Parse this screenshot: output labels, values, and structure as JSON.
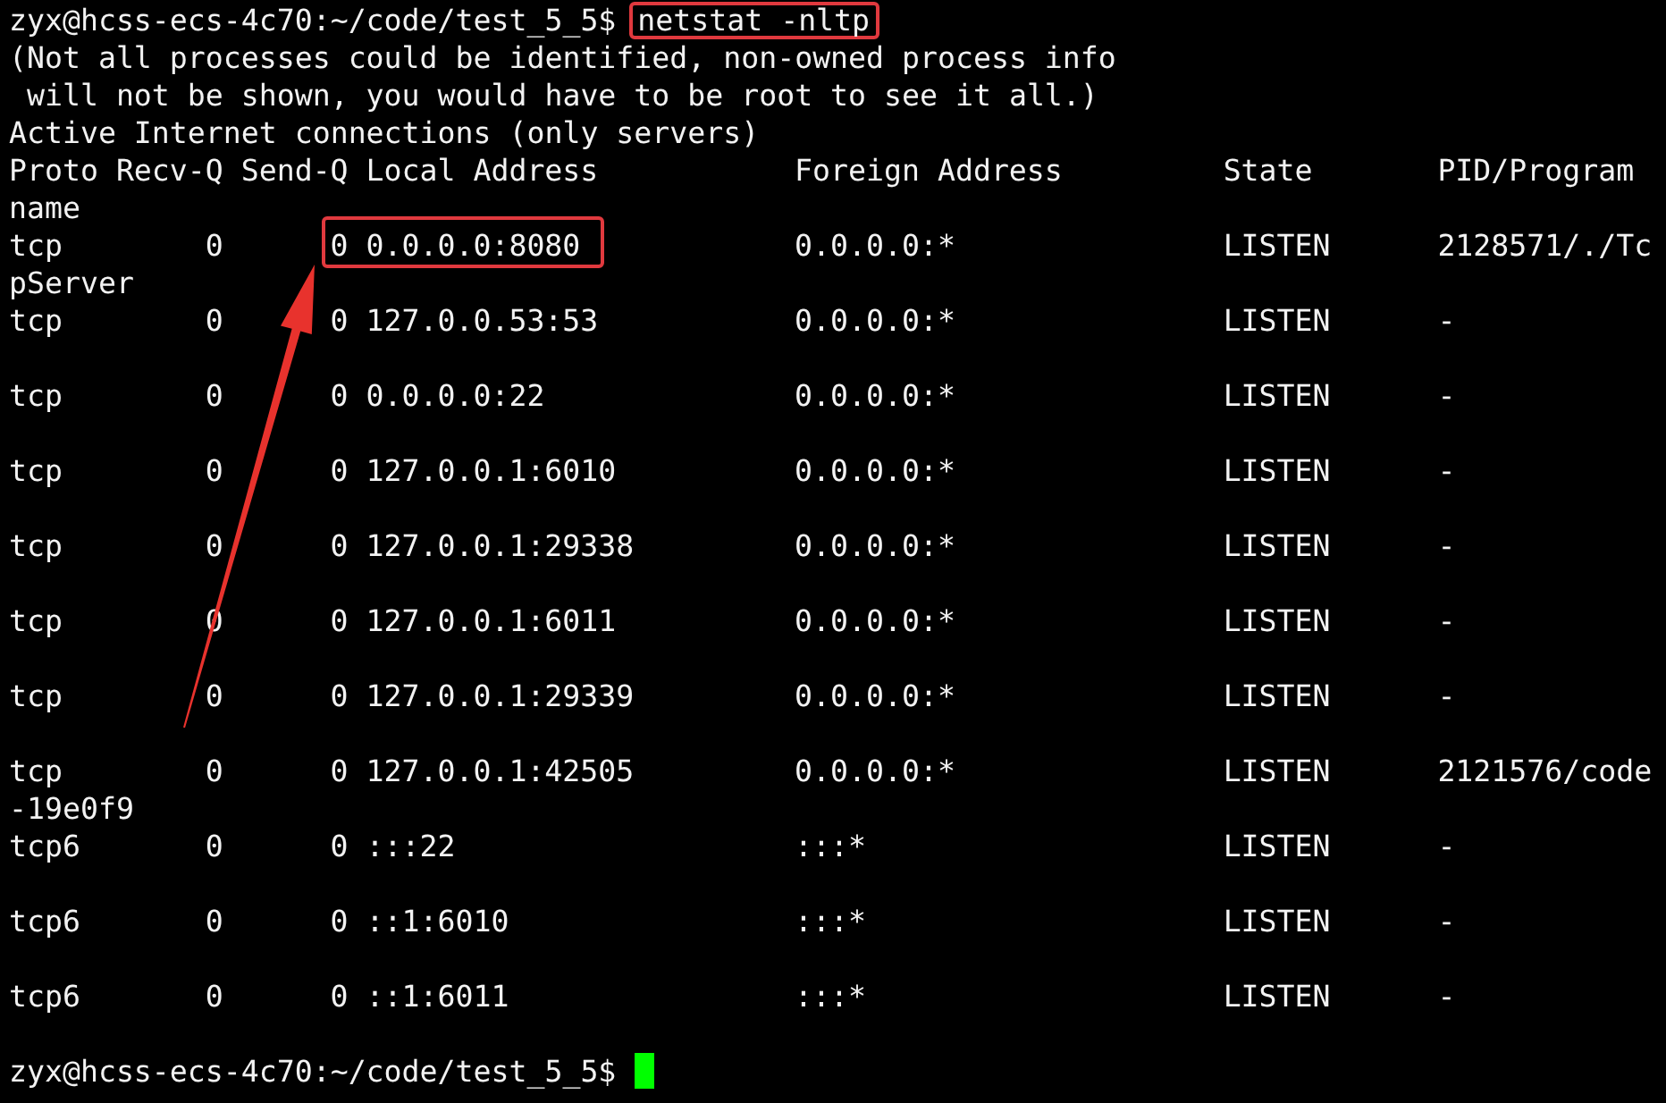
{
  "prompt_top": {
    "prompt": "zyx@hcss-ecs-4c70:~/code/test_5_5$",
    "command": "netstat -nltp",
    "highlighted": true
  },
  "notice_lines": [
    "(Not all processes could be identified, non-owned process info",
    " will not be shown, you would have to be root to see it all.)"
  ],
  "section_title": "Active Internet connections (only servers)",
  "columns": [
    "Proto",
    "Recv-Q",
    "Send-Q",
    "Local Address",
    "Foreign Address",
    "State",
    "PID/Program"
  ],
  "column_wrap": "name",
  "rows": [
    {
      "proto": "tcp",
      "recv_q": "0",
      "send_q": "0",
      "local_address": "0.0.0.0:8080",
      "foreign_address": "0.0.0.0:*",
      "state": "LISTEN",
      "pid_program": "2128571/./Tc",
      "pid_program_wrap": "pServer",
      "highlighted": true
    },
    {
      "proto": "tcp",
      "recv_q": "0",
      "send_q": "0",
      "local_address": "127.0.0.53:53",
      "foreign_address": "0.0.0.0:*",
      "state": "LISTEN",
      "pid_program": "-",
      "highlighted": false
    },
    {
      "proto": "tcp",
      "recv_q": "0",
      "send_q": "0",
      "local_address": "0.0.0.0:22",
      "foreign_address": "0.0.0.0:*",
      "state": "LISTEN",
      "pid_program": "-",
      "highlighted": false
    },
    {
      "proto": "tcp",
      "recv_q": "0",
      "send_q": "0",
      "local_address": "127.0.0.1:6010",
      "foreign_address": "0.0.0.0:*",
      "state": "LISTEN",
      "pid_program": "-",
      "highlighted": false
    },
    {
      "proto": "tcp",
      "recv_q": "0",
      "send_q": "0",
      "local_address": "127.0.0.1:29338",
      "foreign_address": "0.0.0.0:*",
      "state": "LISTEN",
      "pid_program": "-",
      "highlighted": false
    },
    {
      "proto": "tcp",
      "recv_q": "0",
      "send_q": "0",
      "local_address": "127.0.0.1:6011",
      "foreign_address": "0.0.0.0:*",
      "state": "LISTEN",
      "pid_program": "-",
      "highlighted": false
    },
    {
      "proto": "tcp",
      "recv_q": "0",
      "send_q": "0",
      "local_address": "127.0.0.1:29339",
      "foreign_address": "0.0.0.0:*",
      "state": "LISTEN",
      "pid_program": "-",
      "highlighted": false
    },
    {
      "proto": "tcp",
      "recv_q": "0",
      "send_q": "0",
      "local_address": "127.0.0.1:42505",
      "foreign_address": "0.0.0.0:*",
      "state": "LISTEN",
      "pid_program": "2121576/code",
      "pid_program_wrap": "-19e0f9",
      "highlighted": false
    },
    {
      "proto": "tcp6",
      "recv_q": "0",
      "send_q": "0",
      "local_address": ":::22",
      "foreign_address": ":::*",
      "state": "LISTEN",
      "pid_program": "-",
      "highlighted": false
    },
    {
      "proto": "tcp6",
      "recv_q": "0",
      "send_q": "0",
      "local_address": "::1:6010",
      "foreign_address": ":::*",
      "state": "LISTEN",
      "pid_program": "-",
      "highlighted": false
    },
    {
      "proto": "tcp6",
      "recv_q": "0",
      "send_q": "0",
      "local_address": "::1:6011",
      "foreign_address": ":::*",
      "state": "LISTEN",
      "pid_program": "-",
      "highlighted": false
    }
  ],
  "prompt_bottom": {
    "prompt": "zyx@hcss-ecs-4c70:~/code/test_5_5$",
    "cursor": true
  }
}
